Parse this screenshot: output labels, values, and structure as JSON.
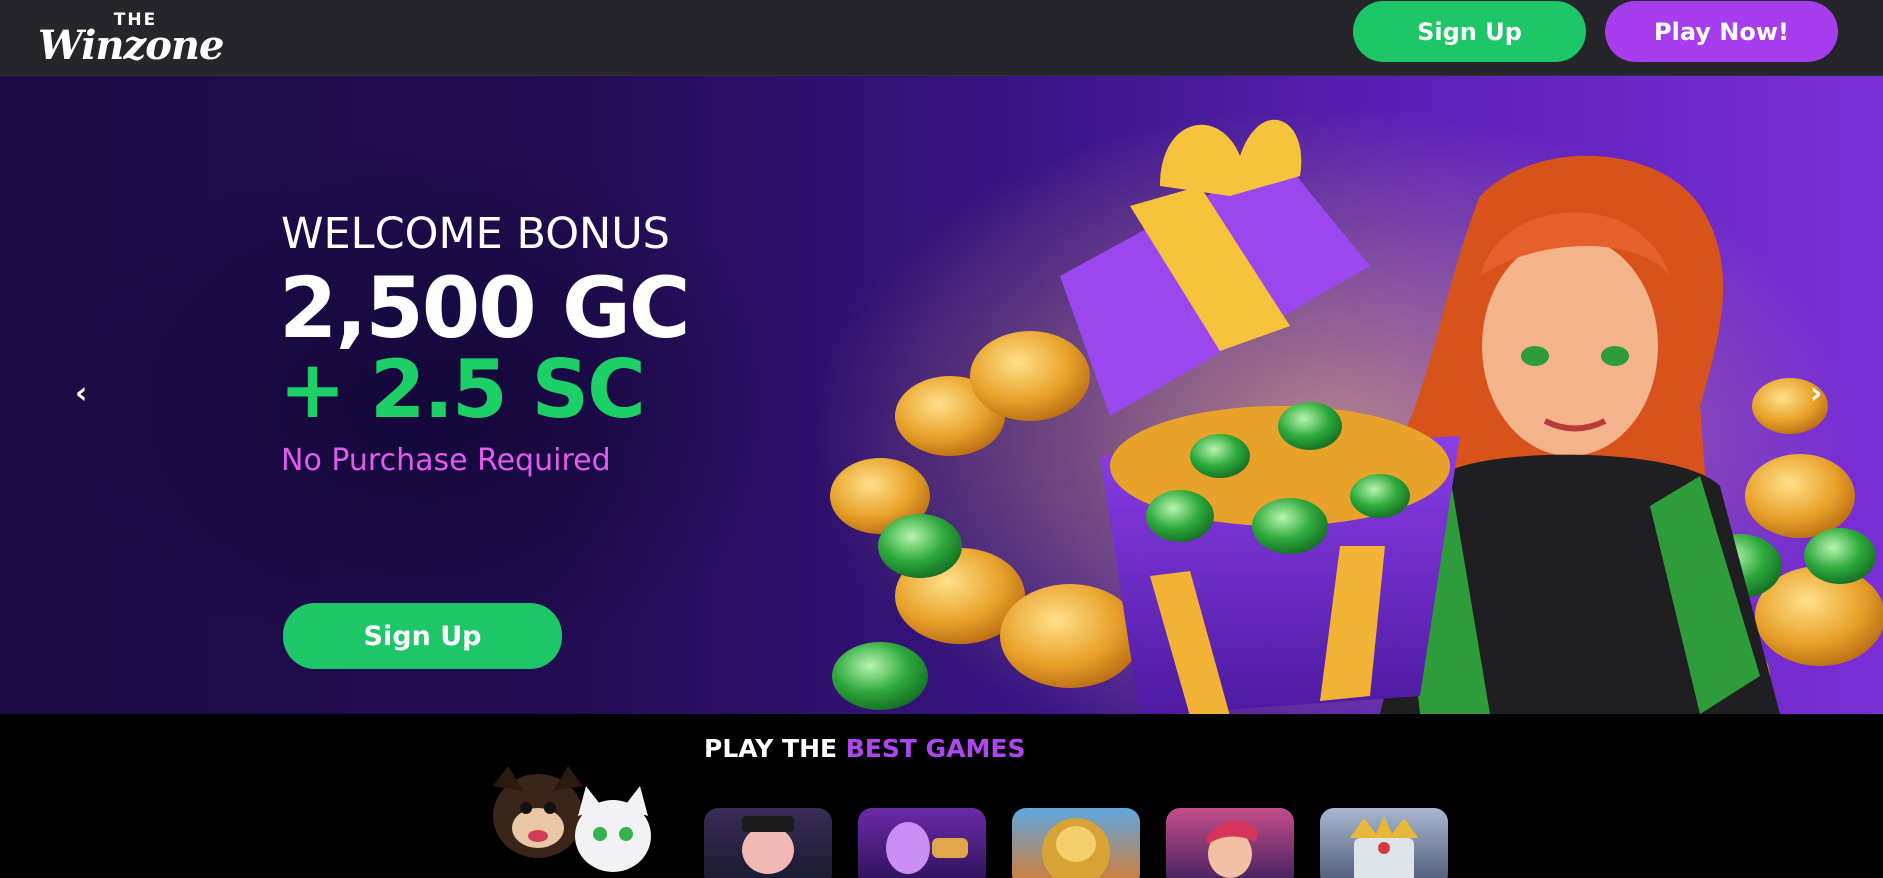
{
  "header": {
    "logo_the": "THE",
    "logo_name": "Winzone",
    "signup_label": "Sign Up",
    "play_label": "Play Now!"
  },
  "hero": {
    "line1": "WELCOME BONUS",
    "line2": "2,500 GC",
    "line3": "+ 2.5 SC",
    "line4": "No Purchase Required",
    "signup_label": "Sign Up",
    "prev_arrow": "‹",
    "next_arrow": "›"
  },
  "games": {
    "title_part1": "PLAY THE ",
    "title_part2": "BEST GAMES"
  },
  "colors": {
    "green": "#1dc767",
    "purple": "#a83df0",
    "pink": "#e25bf0",
    "header_bg": "#26252b"
  }
}
